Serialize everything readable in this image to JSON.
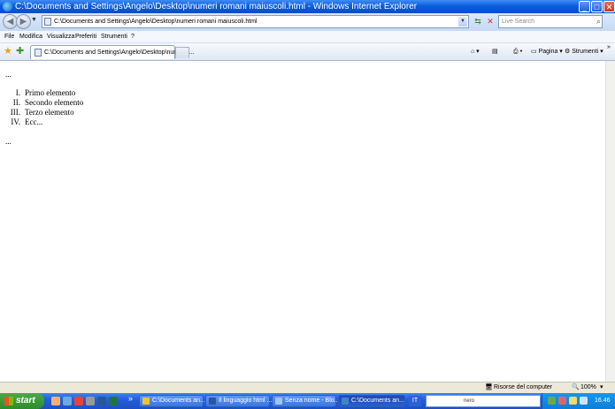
{
  "window": {
    "title": "C:\\Documents and Settings\\Angelo\\Desktop\\numeri romani maiuscoli.html - Windows Internet Explorer",
    "minimize": "_",
    "maximize": "□",
    "close": "✕"
  },
  "address_bar": {
    "url": "C:\\Documents and Settings\\Angelo\\Desktop\\numeri romani maiuscoli.html",
    "search_placeholder": "Live Search"
  },
  "menu": [
    "File",
    "Modifica",
    "Visualizza",
    "Preferiti",
    "Strumenti",
    "?"
  ],
  "tab": {
    "label": "C:\\Documents and Settings\\Angelo\\Desktop\\numeri r..."
  },
  "toolbar": {
    "page_label": "Pagina",
    "tools_label": "Strumenti",
    "more": "»"
  },
  "content": {
    "top_ellipsis": "...",
    "bottom_ellipsis": "...",
    "items": [
      {
        "num": "I.",
        "text": "Primo elemento"
      },
      {
        "num": "II.",
        "text": "Secondo elemento"
      },
      {
        "num": "III.",
        "text": "Terzo elemento"
      },
      {
        "num": "IV.",
        "text": "Ecc..."
      }
    ]
  },
  "statusbar": {
    "zone": "Risorse del computer",
    "zoom": "100%"
  },
  "taskbar": {
    "start_label": "start",
    "more": "»",
    "buttons": [
      {
        "label": "C:\\Documents an...",
        "icon_color": "#f1c232"
      },
      {
        "label": "Il linguaggio html ...",
        "icon_color": "#2b579a"
      },
      {
        "label": "Senza nome - Blo...",
        "icon_color": "#9fc5e8"
      },
      {
        "label": "C:\\Documents an...",
        "icon_color": "#3d85c6"
      }
    ],
    "language": "IT",
    "nero_text": "nero",
    "clock": "16.46"
  }
}
